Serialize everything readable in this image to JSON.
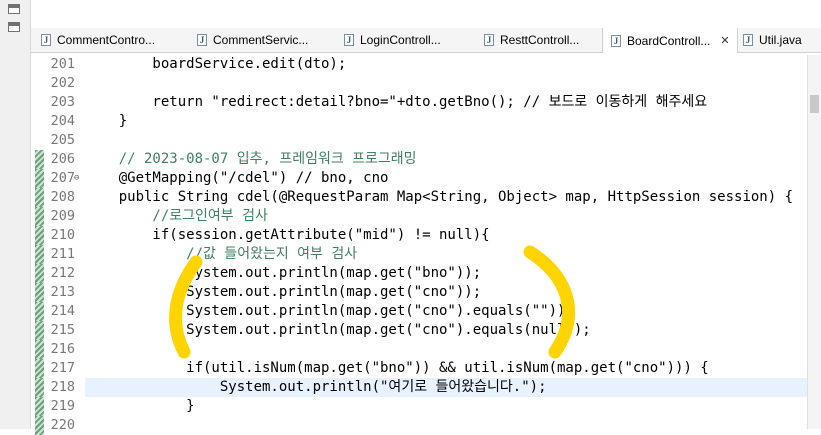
{
  "tabs": [
    {
      "label": "CommentContro...",
      "icon": "java-file-icon"
    },
    {
      "label": "CommentServic...",
      "icon": "java-file-icon"
    },
    {
      "label": "LoginControll...",
      "icon": "java-file-icon"
    },
    {
      "label": "ResttControll...",
      "icon": "java-file-icon"
    },
    {
      "label": "BoardControll...",
      "icon": "java-file-icon",
      "active": true,
      "close": "✕"
    },
    {
      "label": "Util.java",
      "icon": "java-file-icon"
    }
  ],
  "editor": {
    "current_line": "218",
    "lines": [
      {
        "num": "201",
        "text": "        boardService.edit(dto);"
      },
      {
        "num": "202",
        "text": ""
      },
      {
        "num": "203",
        "text": "        return \"redirect:detail?bno=\"+dto.getBno(); // 보드로 이동하게 해주세요"
      },
      {
        "num": "204",
        "text": "    }"
      },
      {
        "num": "205",
        "text": ""
      },
      {
        "num": "206",
        "text": "    // 2023-08-07 입추, 프레임워크 프로그래밍"
      },
      {
        "num": "207",
        "text": "    @GetMapping(\"/cdel\") // bno, cno"
      },
      {
        "num": "208",
        "text": "    public String cdel(@RequestParam Map<String, Object> map, HttpSession session) {"
      },
      {
        "num": "209",
        "text": "        //로그인여부 검사"
      },
      {
        "num": "210",
        "text": "        if(session.getAttribute(\"mid\") != null){"
      },
      {
        "num": "211",
        "text": "            //값 들어왔는지 여부 검사"
      },
      {
        "num": "212",
        "text": "            System.out.println(map.get(\"bno\"));"
      },
      {
        "num": "213",
        "text": "            System.out.println(map.get(\"cno\"));"
      },
      {
        "num": "214",
        "text": "            System.out.println(map.get(\"cno\").equals(\"\"));"
      },
      {
        "num": "215",
        "text": "            System.out.println(map.get(\"cno\").equals(null));"
      },
      {
        "num": "216",
        "text": ""
      },
      {
        "num": "217",
        "text": "            if(util.isNum(map.get(\"bno\")) && util.isNum(map.get(\"cno\"))) {"
      },
      {
        "num": "218",
        "text": "                System.out.println(\"여기로 들어왔습니다.\");"
      },
      {
        "num": "219",
        "text": "            }"
      },
      {
        "num": "220",
        "text": ""
      }
    ]
  },
  "annotation_color": "#ffd400"
}
